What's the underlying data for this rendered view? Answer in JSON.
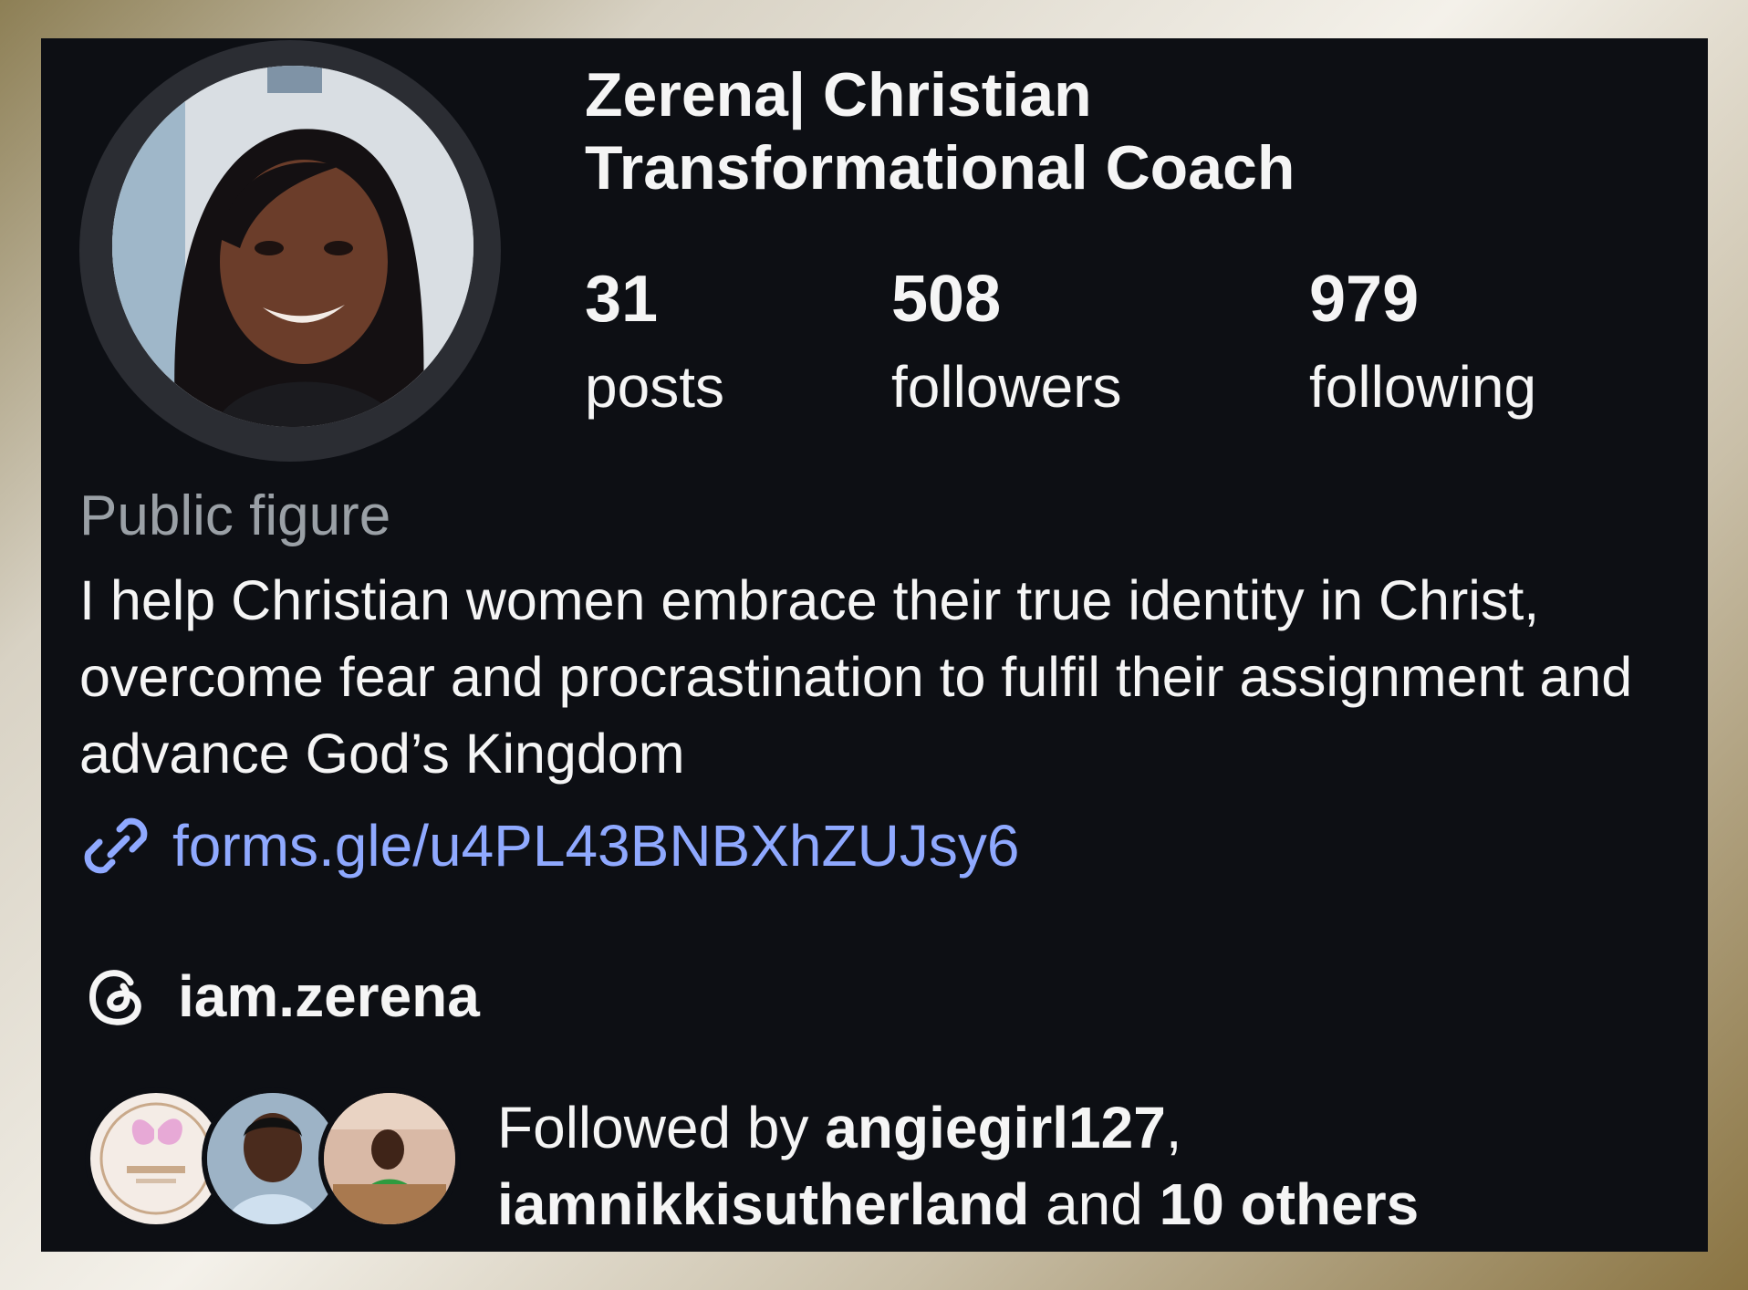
{
  "profile": {
    "display_name": "Zerena| Christian Transformational Coach",
    "avatar_icon": "profile-photo"
  },
  "stats": [
    {
      "value": "31",
      "label": "posts"
    },
    {
      "value": "508",
      "label": "followers"
    },
    {
      "value": "979",
      "label": "following"
    }
  ],
  "category": "Public figure",
  "bio": "I help Christian women embrace their true identity in Christ, overcome fear and procrastination to fulfil their assignment and advance God’s Kingdom",
  "link": {
    "icon": "link-icon",
    "text": "forms.gle/u4PL43BNBXhZUJsy6",
    "color": "#8fa9ff"
  },
  "threads": {
    "icon": "threads-icon",
    "handle": "iam.zerena"
  },
  "followed_by": {
    "prefix": "Followed by ",
    "user1": "angiegirl127",
    "sep": ",",
    "user2": "iamnikkisutherland",
    "mid": " and ",
    "others": "10 others"
  },
  "colors": {
    "panel_bg": "#0d0f14",
    "text": "#f5f5f5",
    "muted": "#9aa0a6",
    "link": "#8fa9ff"
  }
}
